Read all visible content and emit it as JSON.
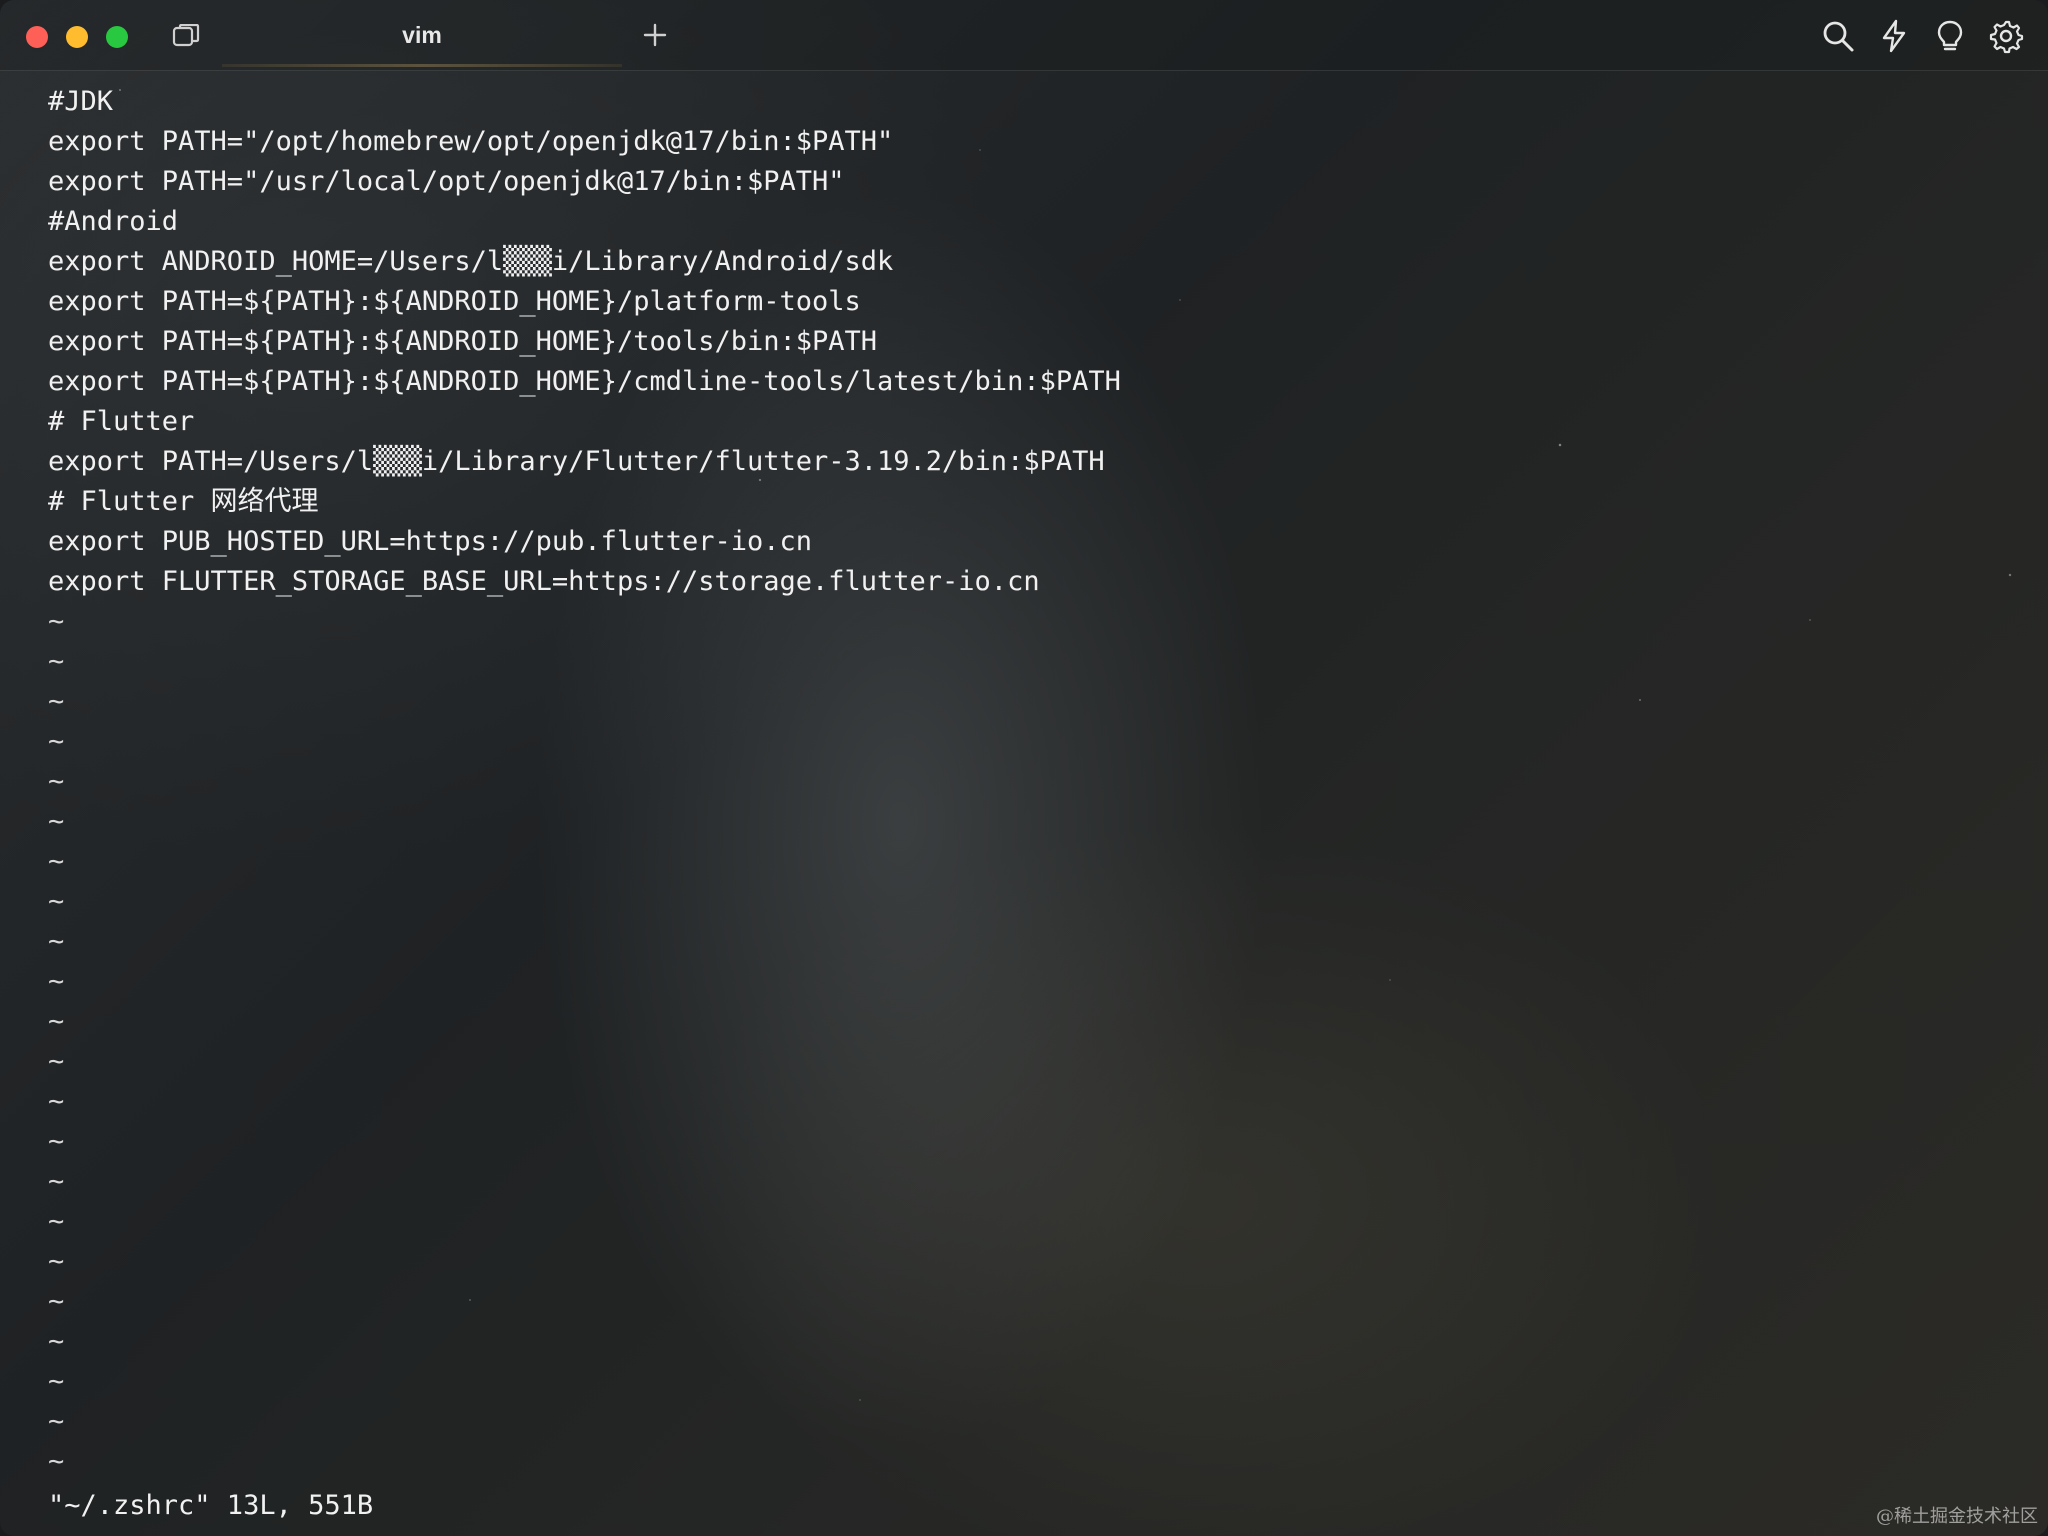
{
  "window": {
    "tab_title": "vim"
  },
  "icons": {
    "tabs_overview": "tabs-overview-icon",
    "new_tab": "plus-icon",
    "search": "search-icon",
    "lightning": "lightning-icon",
    "tips": "lightbulb-icon",
    "settings": "gear-icon"
  },
  "editor": {
    "lines": [
      "#JDK",
      "export PATH=\"/opt/homebrew/opt/openjdk@17/bin:$PATH\"",
      "export PATH=\"/usr/local/opt/openjdk@17/bin:$PATH\"",
      "#Android",
      "export ANDROID_HOME=/Users/l▒▒▒i/Library/Android/sdk",
      "export PATH=${PATH}:${ANDROID_HOME}/platform-tools",
      "export PATH=${PATH}:${ANDROID_HOME}/tools/bin:$PATH",
      "export PATH=${PATH}:${ANDROID_HOME}/cmdline-tools/latest/bin:$PATH",
      "# Flutter",
      "export PATH=/Users/l▒▒▒i/Library/Flutter/flutter-3.19.2/bin:$PATH",
      "# Flutter 网络代理",
      "export PUB_HOSTED_URL=https://pub.flutter-io.cn",
      "export FLUTTER_STORAGE_BASE_URL=https://storage.flutter-io.cn"
    ],
    "tilde": "~",
    "status_line": "\"~/.zshrc\" 13L, 551B"
  },
  "watermark": "@稀土掘金技术社区",
  "colors": {
    "close": "#fe5f57",
    "minimize": "#febc2e",
    "zoom": "#28c840",
    "text": "#f1f1f1"
  }
}
